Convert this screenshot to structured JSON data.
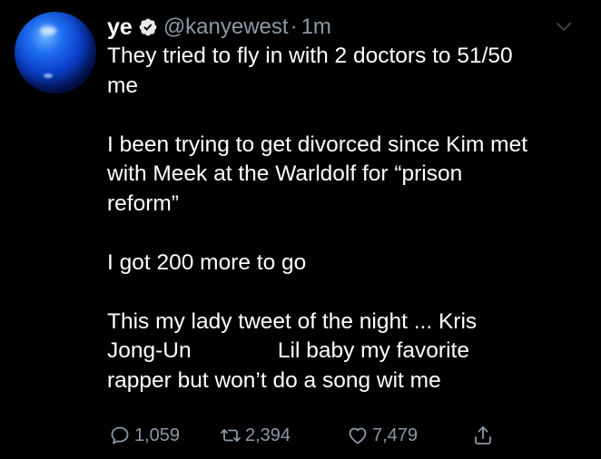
{
  "tweet": {
    "display_name": "ye",
    "handle": "@kanyewest",
    "separator": "·",
    "time": "1m",
    "text": "They tried to fly in with 2 doctors to 51/50\nme\n\nI been trying to get divorced since Kim met\nwith Meek at the Warldolf for “prison\nreform”\n\nI got 200 more to go\n\nThis my lady tweet of the night ... Kris\nJong-Un              Lil baby my favorite\nrapper but won’t do a song wit me",
    "actions": {
      "reply_count": "1,059",
      "retweet_count": "2,394",
      "like_count": "7,479"
    }
  },
  "colors": {
    "background": "#000000",
    "text_primary": "#ffffff",
    "text_secondary": "#8b98a5",
    "verified_badge": "#e7e9ea"
  },
  "icons": {
    "verified": "verified-badge-icon",
    "caret": "chevron-down-icon",
    "reply": "reply-icon",
    "retweet": "retweet-icon",
    "like": "heart-icon",
    "share": "share-icon"
  }
}
